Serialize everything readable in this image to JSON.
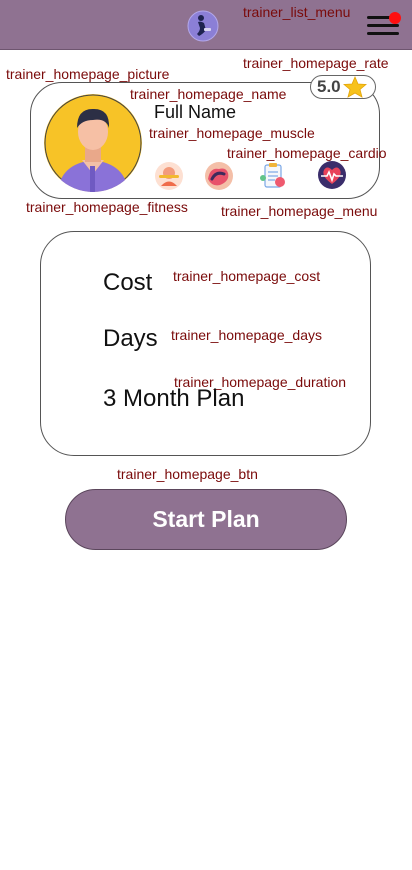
{
  "header": {
    "menu_label": "trainer_list_menu"
  },
  "profile": {
    "picture_label": "trainer_homepage_picture",
    "name_label": "trainer_homepage_name",
    "full_name": "Full Name",
    "rate_label": "trainer_homepage_rate",
    "rating": "5.0",
    "muscle_label": "trainer_homepage_muscle",
    "cardio_label": "trainer_homepage_cardio",
    "fitness_label": "trainer_homepage_fitness",
    "menu_label": "trainer_homepage_menu"
  },
  "plan": {
    "cost_text": "Cost",
    "cost_label": "trainer_homepage_cost",
    "days_text": "Days",
    "days_label": "trainer_homepage_days",
    "duration_text": "3 Month Plan",
    "duration_label": "trainer_homepage_duration"
  },
  "action": {
    "btn_label": "trainer_homepage_btn",
    "start_text": "Start Plan"
  },
  "colors": {
    "topbar": "#8f7291",
    "button": "#8f7291",
    "notification": "#ff1010",
    "debug_label": "#7a0a0a"
  },
  "icons": [
    "app-logo-icon",
    "hamburger-menu-icon",
    "star-icon",
    "fitness-icon",
    "muscle-icon",
    "cardio-clipboard-icon",
    "heartbeat-icon"
  ]
}
